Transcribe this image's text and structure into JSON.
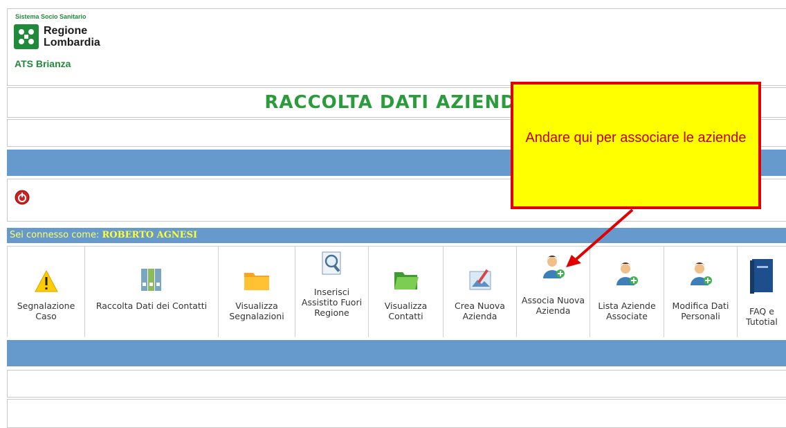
{
  "header": {
    "brand_top": "Sistema Socio Sanitario",
    "brand_name_line1": "Regione",
    "brand_name_line2": "Lombardia",
    "brand_sub": "ATS Brianza"
  },
  "page_title": "RACCOLTA DATI AZIENDE",
  "status": {
    "label": "Sei connesso come: ",
    "user": "ROBERTO AGNESI"
  },
  "menu": [
    {
      "id": "segnalazione",
      "label": "Segnalazione Caso",
      "icon": "warning-icon"
    },
    {
      "id": "raccolta",
      "label": "Raccolta Dati dei Contatti",
      "icon": "binders-icon"
    },
    {
      "id": "visualizza-segnalazioni",
      "label": "Visualizza Segnalazioni",
      "icon": "folder-icon"
    },
    {
      "id": "inserisci",
      "label": "Inserisci Assistito Fuori Regione",
      "icon": "magnifier-document-icon"
    },
    {
      "id": "visualizza-contatti",
      "label": "Visualizza Contatti",
      "icon": "green-folder-icon"
    },
    {
      "id": "crea",
      "label": "Crea Nuova Azienda",
      "icon": "paint-icon"
    },
    {
      "id": "associa",
      "label": "Associa Nuova Azienda",
      "icon": "user-add-icon"
    },
    {
      "id": "lista",
      "label": "Lista Aziende Associate",
      "icon": "user-add-icon"
    },
    {
      "id": "modifica",
      "label": "Modifica Dati Personali",
      "icon": "user-add-icon"
    },
    {
      "id": "faq",
      "label": "FAQ e Tutotial",
      "icon": "book-icon"
    }
  ],
  "callout": {
    "text": "Andare qui per associare le aziende"
  },
  "colors": {
    "accent_green": "#2a9c3c",
    "bar_blue": "#6699cc",
    "callout_yellow": "#ffff00",
    "callout_red": "#e00000"
  }
}
